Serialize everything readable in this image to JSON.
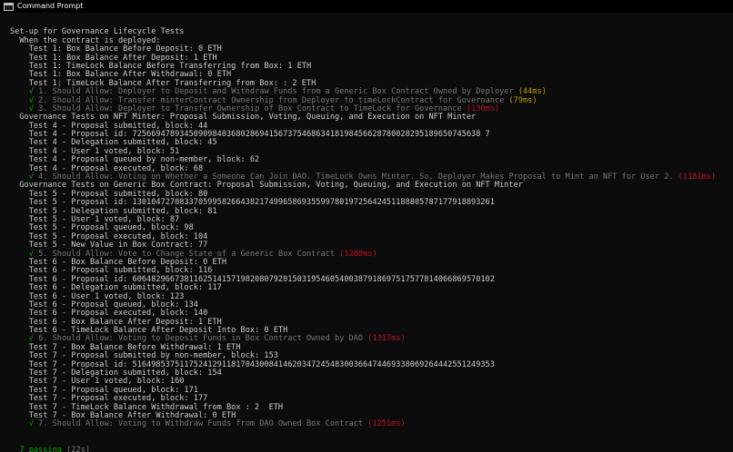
{
  "window": {
    "title": "Command Prompt"
  },
  "console": {
    "lines": [
      {
        "type": "blank"
      },
      {
        "type": "text",
        "indent": "",
        "text": "Set-up for Governance Lifecycle Tests"
      },
      {
        "type": "text",
        "indent": "  ",
        "text": "When the contract is deployed:"
      },
      {
        "type": "text",
        "indent": "    ",
        "text": "Test 1: Box Balance Before Deposit: 0 ETH"
      },
      {
        "type": "text",
        "indent": "    ",
        "text": "Test 1: Box Balance After Deposit: 1 ETH"
      },
      {
        "type": "text",
        "indent": "    ",
        "text": "Test 1: TimeLock Balance Before Transferring from Box: 1 ETH"
      },
      {
        "type": "text",
        "indent": "    ",
        "text": "Test 1: Box Balance After Withdrawal: 0 ETH"
      },
      {
        "type": "text",
        "indent": "    ",
        "text": "Test 1: TimeLock Balance After Transferring from Box: : 2 ETH"
      },
      {
        "type": "pass",
        "indent": "    ",
        "check": "√",
        "text": "1. Should Allow: Deployer to Deposit and Withdraw Funds from a Generic Box Contract Owned by Deployer",
        "duration": "(44ms)",
        "dur_class": "dur-med"
      },
      {
        "type": "pass",
        "indent": "    ",
        "check": "√",
        "text": "2. Should Allow: Transfer minterContract Ownership from Deployer to timeLockContract for Governance",
        "duration": "(79ms)",
        "dur_class": "dur-med"
      },
      {
        "type": "pass",
        "indent": "    ",
        "check": "√",
        "text": "3. Should Allow: Deployer to Transfer Ownership of Box Contract to TimeLock for Governance",
        "duration": "(130ms)",
        "dur_class": "dur-slow"
      },
      {
        "type": "text",
        "indent": "  ",
        "text": "Governance Tests on NFT Minter: Proposal Submission, Voting, Queuing, and Execution on NFT Minter"
      },
      {
        "type": "text",
        "indent": "    ",
        "text": "Test 4 - Proposal submitted, block: 44"
      },
      {
        "type": "text",
        "indent": "    ",
        "text": "Test 4 - Proposal id: 72566947893450909840368028694156737546863418198456628780028295189650745638 7"
      },
      {
        "type": "text",
        "indent": "    ",
        "text": "Test 4 - Delegation submitted, block: 45"
      },
      {
        "type": "text",
        "indent": "    ",
        "text": "Test 4 - User 1 voted, block: 51"
      },
      {
        "type": "text",
        "indent": "    ",
        "text": "Test 4 - Proposal queued by non-member, block: 62"
      },
      {
        "type": "text",
        "indent": "    ",
        "text": "Test 4 - Proposal executed, block: 68"
      },
      {
        "type": "pass",
        "indent": "    ",
        "check": "√",
        "text": "4. Should Allow: Voting on Whether a Someone Can Join DAO. TimeLock Owns Minter. So, Deployer Makes Proposal to Mint an NFT for User 2.",
        "duration": "(1181ms)",
        "dur_class": "dur-slow"
      },
      {
        "type": "text",
        "indent": "  ",
        "text": "Governance Tests on Generic Box Contract: Proposal Submission, Voting, Queuing, and Execution on NFT Minter"
      },
      {
        "type": "text",
        "indent": "    ",
        "text": "Test 5 - Proposal submitted, block: 80"
      },
      {
        "type": "text",
        "indent": "    ",
        "text": "Test 5 - Proposal id: 13010472708337059958266438217499658693559978019725642451188805787177918893261"
      },
      {
        "type": "text",
        "indent": "    ",
        "text": "Test 5 - Delegation submitted, block: 81"
      },
      {
        "type": "text",
        "indent": "    ",
        "text": "Test 5 - User 1 voted, block: 87"
      },
      {
        "type": "text",
        "indent": "    ",
        "text": "Test 5 - Proposal queued, block: 98"
      },
      {
        "type": "text",
        "indent": "    ",
        "text": "Test 5 - Proposal executed, block: 104"
      },
      {
        "type": "text",
        "indent": "    ",
        "text": "Test 5 - New Value in Box Contract: 77"
      },
      {
        "type": "pass",
        "indent": "    ",
        "check": "√",
        "text": "5. Should Allow: Vote to Change State of a Generic Box Contract",
        "duration": "(1280ms)",
        "dur_class": "dur-slow"
      },
      {
        "type": "text",
        "indent": "    ",
        "text": "Test 6 - Box Balance Before Deposit: 0 ETH"
      },
      {
        "type": "text",
        "indent": "    ",
        "text": "Test 6 - Proposal submitted, block: 116"
      },
      {
        "type": "text",
        "indent": "    ",
        "text": "Test 6 - Proposal id: 60648296673811625141571982080792015031954605400387918697517577814066869570102"
      },
      {
        "type": "text",
        "indent": "    ",
        "text": "Test 6 - Delegation submitted, block: 117"
      },
      {
        "type": "text",
        "indent": "    ",
        "text": "Test 6 - User 1 voted, block: 123"
      },
      {
        "type": "text",
        "indent": "    ",
        "text": "Test 6 - Proposal queued, block: 134"
      },
      {
        "type": "text",
        "indent": "    ",
        "text": "Test 6 - Proposal executed, block: 140"
      },
      {
        "type": "text",
        "indent": "    ",
        "text": "Test 6 - Box Balance After Deposit: 1 ETH"
      },
      {
        "type": "text",
        "indent": "    ",
        "text": "Test 6 - TimeLock Balance After Deposit Into Box: 0 ETH"
      },
      {
        "type": "pass",
        "indent": "    ",
        "check": "√",
        "text": "6. Should Allow: Voting to Deposit Funds in Box Contract Owned by DAO",
        "duration": "(1317ms)",
        "dur_class": "dur-slow"
      },
      {
        "type": "text",
        "indent": "    ",
        "text": "Test 7 - Box Balance Before Withdrawal: 1 ETH"
      },
      {
        "type": "text",
        "indent": "    ",
        "text": "Test 7 - Proposal submitted by non-member, block: 153"
      },
      {
        "type": "text",
        "indent": "    ",
        "text": "Test 7 - Proposal id: 51649853751175241291181704300841462034724548300366474469338069264442551249353"
      },
      {
        "type": "text",
        "indent": "    ",
        "text": "Test 7 - Delegation submitted, block: 154"
      },
      {
        "type": "text",
        "indent": "    ",
        "text": "Test 7 - User 1 voted, block: 160"
      },
      {
        "type": "text",
        "indent": "    ",
        "text": "Test 7 - Proposal queued, block: 171"
      },
      {
        "type": "text",
        "indent": "    ",
        "text": "Test 7 - Proposal executed, block: 177"
      },
      {
        "type": "text",
        "indent": "    ",
        "text": "Test 7 - TimeLock Balance Withdrawal from Box : 2  ETH"
      },
      {
        "type": "text",
        "indent": "    ",
        "text": "Test 7 - Box Balance After Withdrawal: 0 ETH"
      },
      {
        "type": "pass",
        "indent": "    ",
        "check": "√",
        "text": "7. Should Allow: Voting to Withdraw Funds from DAO Owned Box Contract",
        "duration": "(1251ms)",
        "dur_class": "dur-slow"
      },
      {
        "type": "blank"
      },
      {
        "type": "blank"
      },
      {
        "type": "summary",
        "indent": "  ",
        "count": "7 passing",
        "duration": "(22s)"
      }
    ]
  }
}
